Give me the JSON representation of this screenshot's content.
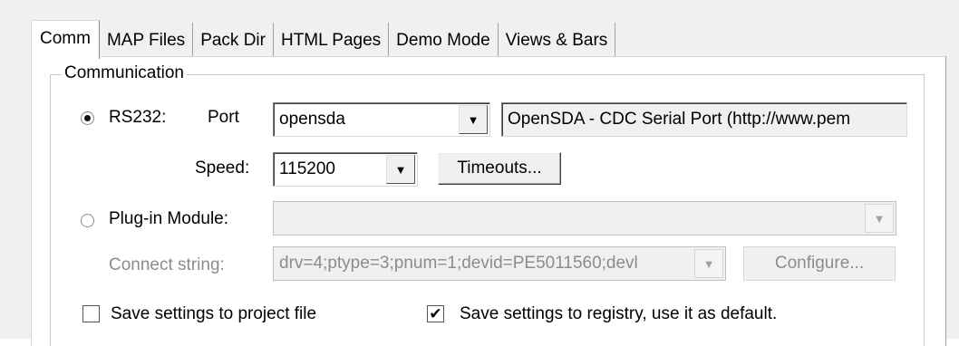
{
  "tabs": [
    "Comm",
    "MAP Files",
    "Pack Dir",
    "HTML Pages",
    "Demo Mode",
    "Views & Bars"
  ],
  "group_title": "Communication",
  "rs232": {
    "radio_label": "RS232:",
    "port_label": "Port",
    "port_value": "opensda",
    "port_description": "OpenSDA - CDC Serial Port (http://www.pem",
    "speed_label": "Speed:",
    "speed_value": "115200",
    "timeouts_button": "Timeouts..."
  },
  "plugin": {
    "radio_label": "Plug-in Module:",
    "module_value": "",
    "connect_label": "Connect string:",
    "connect_value": "drv=4;ptype=3;pnum=1;devid=PE5011560;devl",
    "configure_button": "Configure..."
  },
  "options": {
    "save_project_label": "Save settings to project file",
    "save_registry_label": "Save settings to registry, use it as default."
  },
  "state": {
    "rs232_selected": true,
    "save_project_checked": false,
    "save_registry_checked": true
  },
  "icons": {
    "dropdown": "chevron-down-icon",
    "check": "check-icon"
  }
}
